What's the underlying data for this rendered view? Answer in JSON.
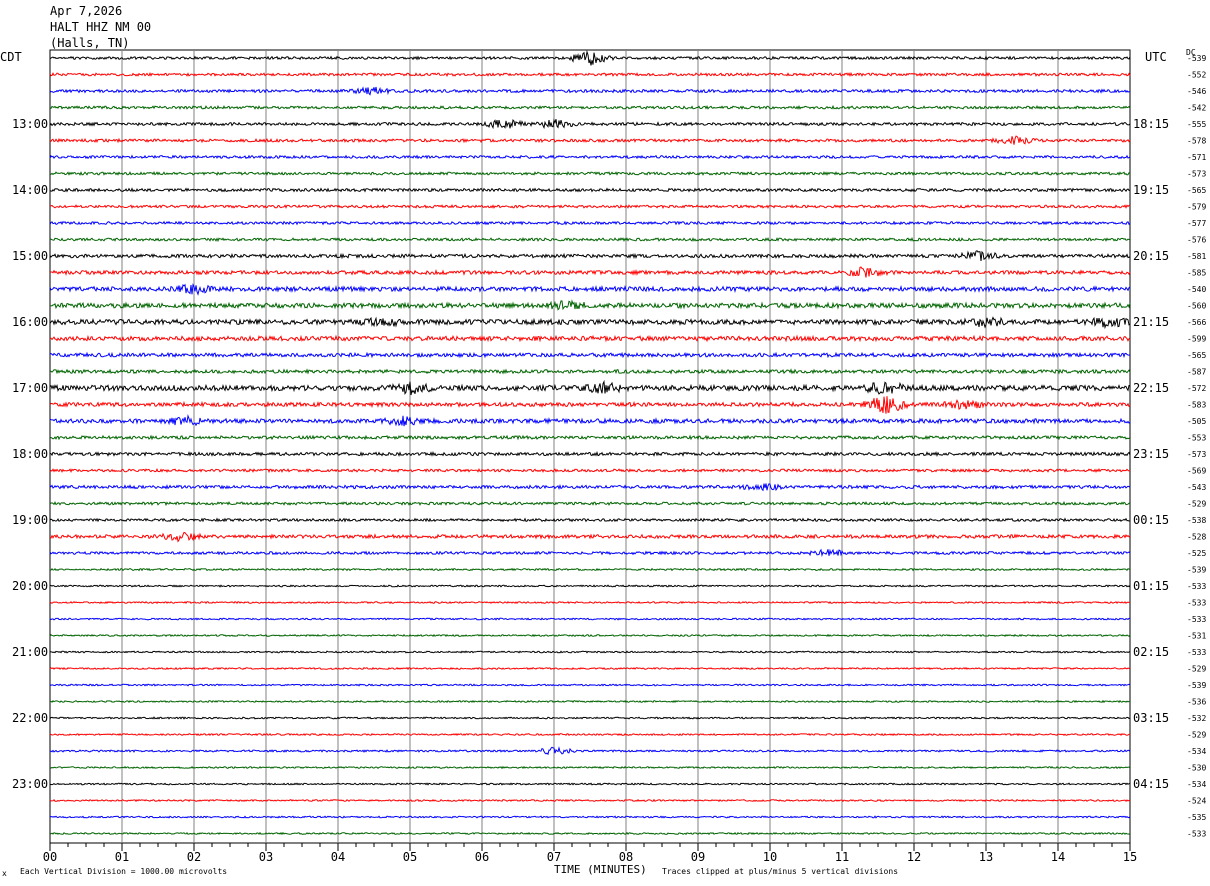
{
  "header": {
    "date": "Apr 7,2026",
    "station": "HALT HHZ NM 00",
    "location": "(Halls, TN)"
  },
  "left_tz": "CDT",
  "right_tz": "UTC",
  "dc_label": "DC",
  "footer": {
    "scale_note": "Each Vertical Division = 1000.00 microvolts",
    "clip_note": "Traces clipped at plus/minus 5 vertical divisions",
    "mark": "x"
  },
  "colors": {
    "trace_cycle": [
      "#000000",
      "#ff0000",
      "#0000ff",
      "#006400"
    ],
    "gridline": "#808080"
  },
  "chart_data": {
    "type": "line",
    "xlabel": "TIME (MINUTES)",
    "xlim": [
      0,
      15
    ],
    "x_ticks": [
      "00",
      "01",
      "02",
      "03",
      "04",
      "05",
      "06",
      "07",
      "08",
      "09",
      "10",
      "11",
      "12",
      "13",
      "14",
      "15"
    ],
    "left_hour_labels": [
      "13:00",
      "14:00",
      "15:00",
      "16:00",
      "17:00",
      "18:00",
      "19:00",
      "20:00",
      "21:00",
      "22:00",
      "23:00"
    ],
    "right_hour_labels": [
      "18:15",
      "19:15",
      "20:15",
      "21:15",
      "22:15",
      "23:15",
      "00:15",
      "01:15",
      "02:15",
      "03:15",
      "04:15"
    ],
    "dc_offsets": [
      -539,
      -552,
      -546,
      -542,
      -555,
      -578,
      -571,
      -573,
      -565,
      -579,
      -577,
      -576,
      -581,
      -585,
      -540,
      -560,
      -566,
      -599,
      -565,
      -587,
      -572,
      -583,
      -505,
      -553,
      -573,
      -569,
      -543,
      -529,
      -538,
      -528,
      -525,
      -539,
      -533,
      -533,
      -533,
      -531,
      -533,
      -529,
      -539,
      -536,
      -532,
      -529,
      -534,
      -530,
      -534,
      -524,
      -535,
      -533
    ],
    "trace_activity": [
      1.0,
      1.0,
      1.1,
      1.0,
      1.1,
      1.1,
      1.0,
      1.0,
      1.1,
      1.0,
      1.0,
      1.0,
      1.3,
      1.4,
      1.7,
      1.8,
      1.9,
      1.7,
      1.4,
      1.3,
      2.0,
      1.5,
      1.6,
      1.2,
      1.2,
      1.0,
      1.2,
      1.0,
      1.0,
      1.3,
      1.0,
      0.7,
      0.6,
      0.6,
      0.6,
      0.6,
      0.6,
      0.6,
      0.6,
      0.6,
      0.6,
      0.6,
      0.7,
      0.6,
      0.6,
      0.6,
      0.6,
      0.6
    ],
    "bursts": [
      {
        "trace": 0,
        "minute": 7.5,
        "amp": 4.0
      },
      {
        "trace": 4,
        "minute": 6.3,
        "amp": 2.5
      },
      {
        "trace": 4,
        "minute": 7.0,
        "amp": 2.5
      },
      {
        "trace": 2,
        "minute": 4.5,
        "amp": 2.0
      },
      {
        "trace": 5,
        "minute": 13.4,
        "amp": 2.0
      },
      {
        "trace": 12,
        "minute": 12.9,
        "amp": 2.5
      },
      {
        "trace": 13,
        "minute": 11.3,
        "amp": 2.5
      },
      {
        "trace": 14,
        "minute": 2.0,
        "amp": 2.2
      },
      {
        "trace": 15,
        "minute": 7.2,
        "amp": 2.5
      },
      {
        "trace": 16,
        "minute": 4.6,
        "amp": 2.5
      },
      {
        "trace": 16,
        "minute": 13.0,
        "amp": 2.2
      },
      {
        "trace": 16,
        "minute": 14.7,
        "amp": 2.2
      },
      {
        "trace": 20,
        "minute": 5.0,
        "amp": 3.0
      },
      {
        "trace": 20,
        "minute": 7.7,
        "amp": 2.5
      },
      {
        "trace": 20,
        "minute": 11.6,
        "amp": 3.0
      },
      {
        "trace": 21,
        "minute": 11.6,
        "amp": 6.0
      },
      {
        "trace": 21,
        "minute": 12.7,
        "amp": 2.5
      },
      {
        "trace": 22,
        "minute": 1.9,
        "amp": 2.5
      },
      {
        "trace": 22,
        "minute": 4.9,
        "amp": 2.0
      },
      {
        "trace": 26,
        "minute": 9.9,
        "amp": 2.0
      },
      {
        "trace": 29,
        "minute": 1.8,
        "amp": 2.2
      },
      {
        "trace": 30,
        "minute": 10.8,
        "amp": 2.0
      },
      {
        "trace": 42,
        "minute": 7.0,
        "amp": 2.0
      }
    ]
  }
}
